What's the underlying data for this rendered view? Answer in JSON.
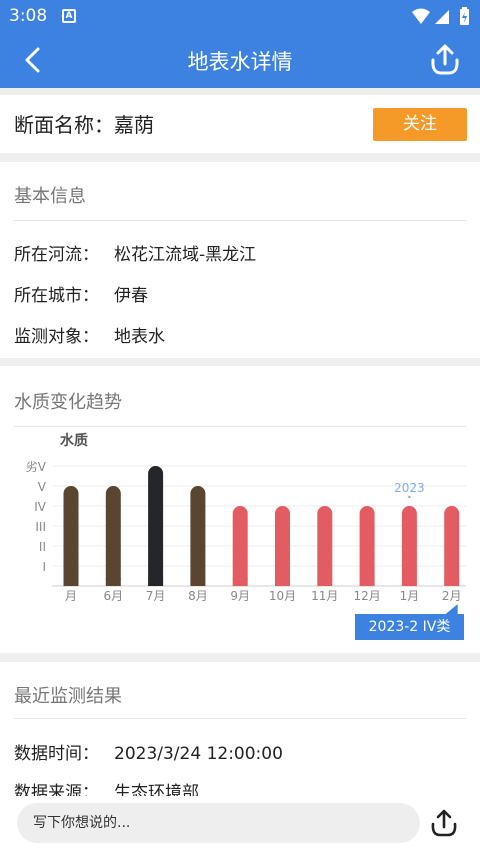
{
  "status_bar": {
    "time": "3:08",
    "sim_label": "A"
  },
  "app_bar": {
    "title": "地表水详情"
  },
  "section_name": {
    "label": "断面名称：嘉荫",
    "follow_button": "关注"
  },
  "basic_info": {
    "title": "基本信息",
    "rows": [
      {
        "key": "所在河流：",
        "value": "松花江流域-黑龙江"
      },
      {
        "key": "所在城市：",
        "value": "伊春"
      },
      {
        "key": "监测对象：",
        "value": "地表水"
      }
    ]
  },
  "trend": {
    "title": "水质变化趋势",
    "tooltip": "2023-2 IV类"
  },
  "chart_data": {
    "type": "bar",
    "ylabel": "水质",
    "y_ticks": [
      "劣V",
      "V",
      "IV",
      "III",
      "II",
      "I"
    ],
    "categories": [
      "月",
      "6月",
      "7月",
      "8月",
      "9月",
      "10月",
      "11月",
      "12月",
      "1月",
      "2月"
    ],
    "values": [
      5,
      5,
      6,
      5,
      4,
      4,
      4,
      4,
      4,
      4
    ],
    "value_labels": [
      "V",
      "V",
      "劣V",
      "V",
      "IV",
      "IV",
      "IV",
      "IV",
      "IV",
      "IV"
    ],
    "year_marker": {
      "label": "2023",
      "category": "1月"
    },
    "colors": {
      "V": "#5a4530",
      "劣V": "#24262a",
      "IV": "#e35c62"
    }
  },
  "recent": {
    "title": "最近监测结果",
    "rows": [
      {
        "key": "数据时间：",
        "value": "2023/3/24 12:00:00"
      },
      {
        "key": "数据来源：",
        "value": "生态环境部"
      }
    ]
  },
  "bottom_bar": {
    "placeholder": "写下你想说的..."
  }
}
